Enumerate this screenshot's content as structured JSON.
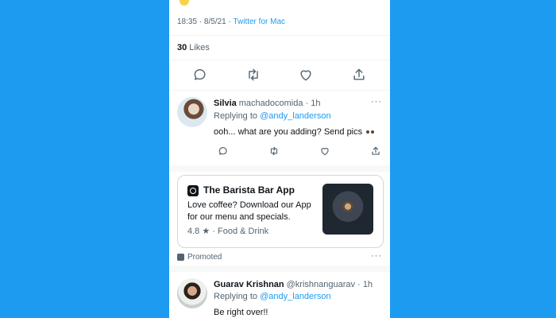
{
  "tweet": {
    "timestamp": "18:35 · 8/5/21 ·",
    "source": "Twitter for Mac",
    "likes_count": "30",
    "likes_label": "Likes"
  },
  "replies": [
    {
      "display_name": "Silvia",
      "username": "machadocomida",
      "time": "· 1h",
      "replying_prefix": "Replying to",
      "replying_handle": "@andy_landerson",
      "text": "ooh... what are you adding? Send pics"
    },
    {
      "display_name": "Guarav Krishnan",
      "username": "@krishnanguarav",
      "time": "· 1h",
      "replying_prefix": "Replying to",
      "replying_handle": "@andy_landerson",
      "text": "Be right over!!"
    }
  ],
  "ad": {
    "title": "The Barista Bar App",
    "description": "Love coffee? Download our App for our menu and specials.",
    "rating": "4.8 ★ · Food & Drink",
    "promoted_label": "Promoted"
  },
  "more_glyph": "···",
  "icons": [
    "reply-icon",
    "retweet-icon",
    "like-icon",
    "share-icon",
    "promoted-icon",
    "more-icon"
  ],
  "colors": {
    "background": "#1d9bf0",
    "accent": "#1d9bf0",
    "text": "#0f1419",
    "secondary_text": "#536471"
  }
}
